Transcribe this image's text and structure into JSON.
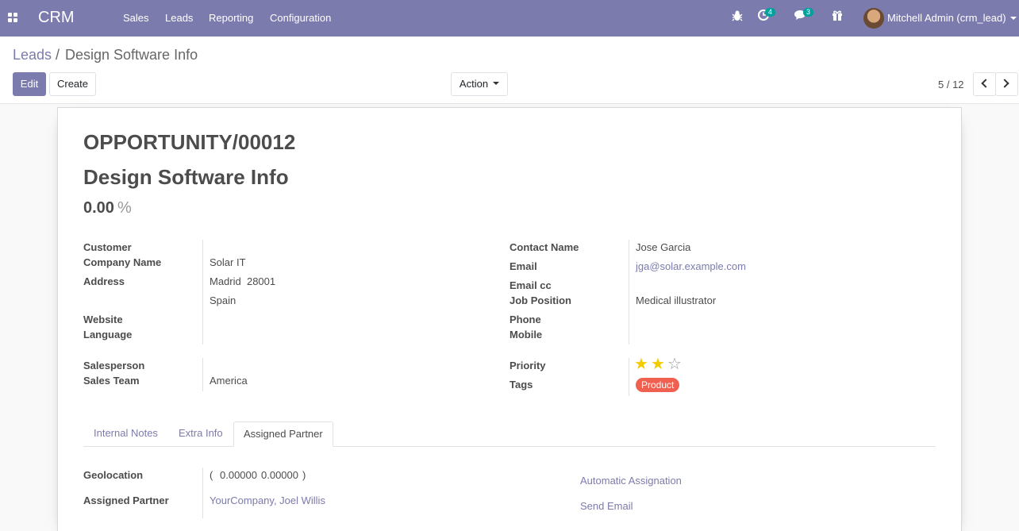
{
  "navbar": {
    "app_name": "CRM",
    "menu": [
      "Sales",
      "Leads",
      "Reporting",
      "Configuration"
    ],
    "activity_count": "4",
    "message_count": "3",
    "user": "Mitchell Admin (crm_lead)",
    "accent_color": "#7c7bad"
  },
  "breadcrumb": {
    "parent": "Leads",
    "separator": "/",
    "current": "Design Software Info"
  },
  "control": {
    "edit_label": "Edit",
    "create_label": "Create",
    "action_label": "Action",
    "pager": "5 / 12"
  },
  "form": {
    "reference": "OPPORTUNITY/00012",
    "name": "Design Software Info",
    "probability": "0.00",
    "probability_unit": "%",
    "left": {
      "customer_label": "Customer",
      "company_label": "Company Name",
      "company_value": "Solar IT",
      "address_label": "Address",
      "address_line1": "Madrid  28001",
      "address_line2": "Spain",
      "website_label": "Website",
      "language_label": "Language",
      "salesperson_label": "Salesperson",
      "team_label": "Sales Team",
      "team_value": "America"
    },
    "right": {
      "contact_label": "Contact Name",
      "contact_value": "Jose Garcia",
      "email_label": "Email",
      "email_value": "jga@solar.example.com",
      "emailcc_label": "Email cc",
      "job_label": "Job Position",
      "job_value": "Medical illustrator",
      "phone_label": "Phone",
      "mobile_label": "Mobile",
      "priority_label": "Priority",
      "priority_value": 2,
      "priority_max": 3,
      "tags_label": "Tags",
      "tag": "Product",
      "tag_color": "#f06050"
    },
    "tabs": [
      "Internal Notes",
      "Extra Info",
      "Assigned Partner"
    ],
    "active_tab": "Assigned Partner",
    "assigned": {
      "geo_label": "Geolocation",
      "geo_open": "(",
      "geo_lat": "0.00000",
      "geo_lng": "0.00000",
      "geo_close": ")",
      "partner_label": "Assigned Partner",
      "partner_value": "YourCompany, Joel Willis",
      "auto_assign": "Automatic Assignation",
      "send_email": "Send Email"
    }
  }
}
